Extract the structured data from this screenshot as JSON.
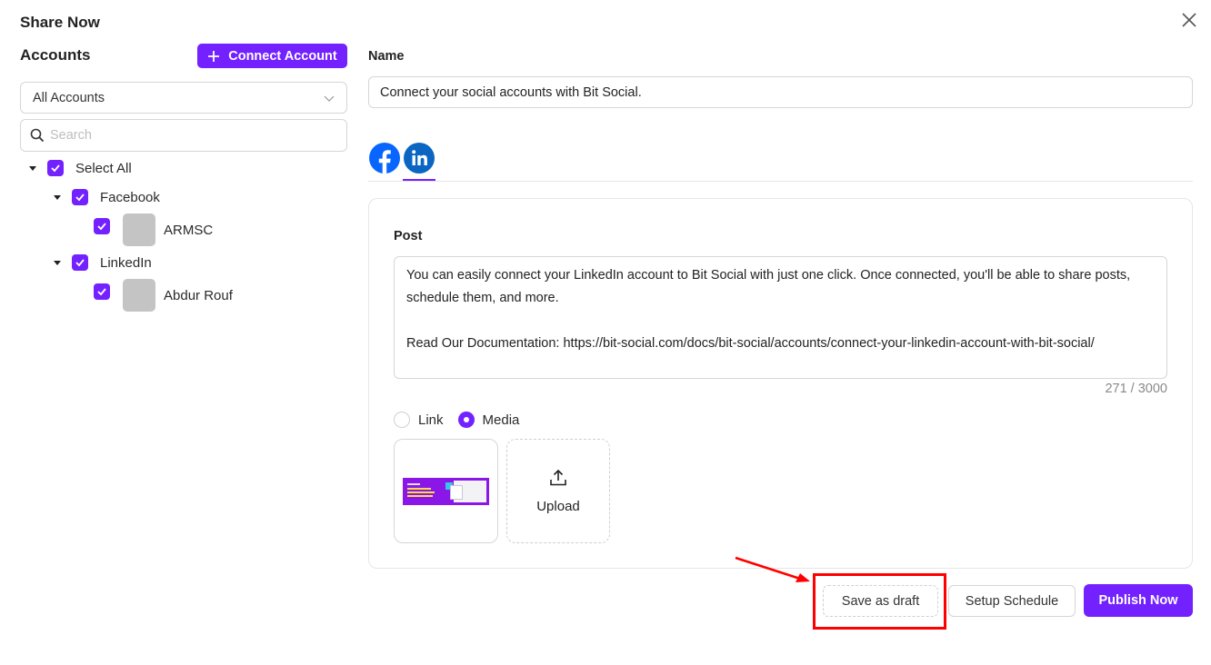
{
  "dialog": {
    "title": "Share Now",
    "close_icon": "close-icon"
  },
  "accounts": {
    "label": "Accounts",
    "connect_button": "Connect Account",
    "filter_selected": "All Accounts",
    "search_placeholder": "Search",
    "tree": {
      "select_all": {
        "label": "Select All",
        "checked": true
      },
      "groups": [
        {
          "label": "Facebook",
          "checked": true,
          "children": [
            {
              "label": "ARMSC",
              "checked": true
            }
          ]
        },
        {
          "label": "LinkedIn",
          "checked": true,
          "children": [
            {
              "label": "Abdur Rouf",
              "checked": true
            }
          ]
        }
      ]
    }
  },
  "form": {
    "name_label": "Name",
    "name_value": "Connect your social accounts with Bit Social.",
    "platform_tabs": [
      {
        "icon": "facebook-icon",
        "active": false
      },
      {
        "icon": "linkedin-icon",
        "active": true
      }
    ],
    "post_label": "Post",
    "post_value": "You can easily connect your LinkedIn account to Bit Social with just one click. Once connected, you'll be able to share posts, schedule them, and more.\n\nRead Our Documentation: https://bit-social.com/docs/bit-social/accounts/connect-your-linkedin-account-with-bit-social/",
    "char_count": "271 / 3000",
    "attachment_type": {
      "options": [
        "Link",
        "Media"
      ],
      "selected": "Media"
    },
    "upload_label": "Upload"
  },
  "footer": {
    "save_draft": "Save as draft",
    "setup_schedule": "Setup Schedule",
    "publish_now": "Publish Now"
  },
  "colors": {
    "accent": "#7322ff",
    "highlight": "#ff0000"
  }
}
